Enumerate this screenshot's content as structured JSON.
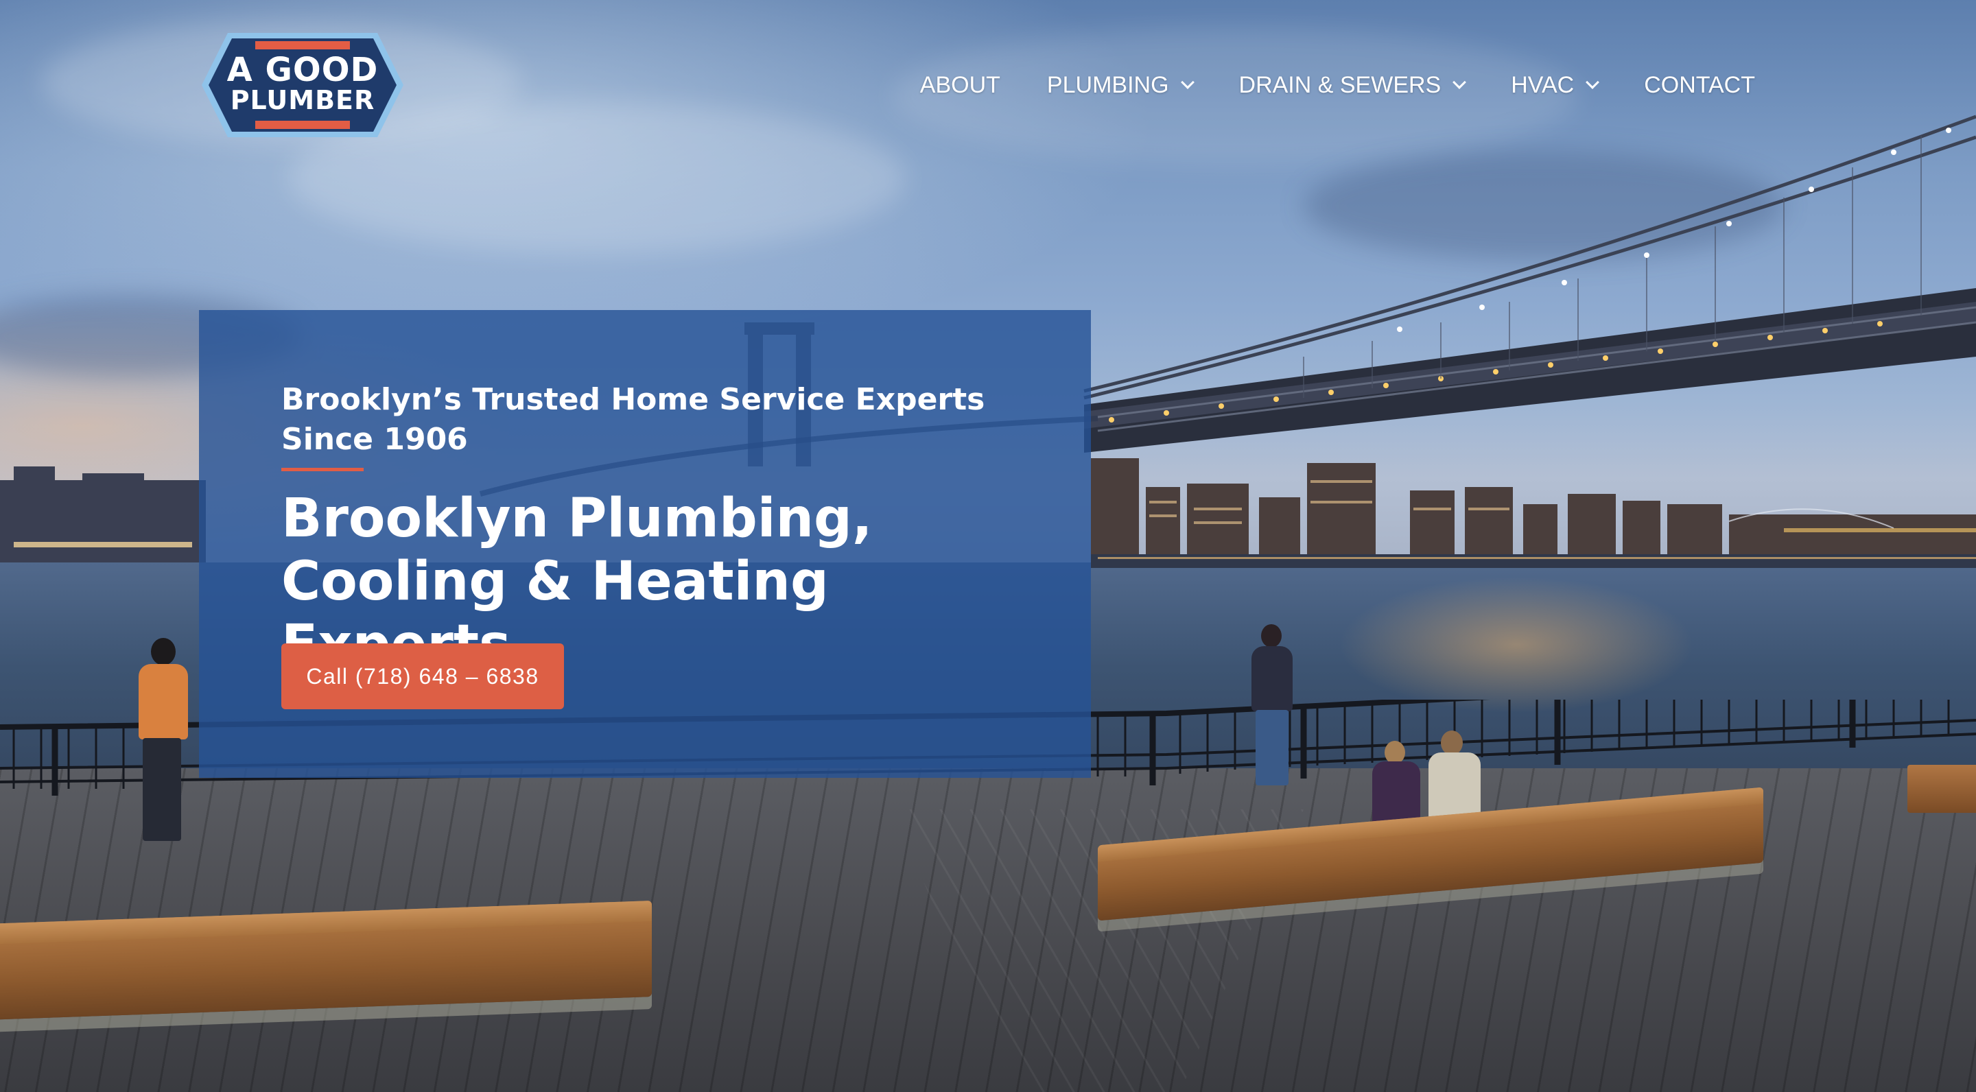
{
  "brand": {
    "logo_line1": "A GOOD",
    "logo_line2": "PLUMBER",
    "colors": {
      "navy": "#1f3b6b",
      "accent": "#e25d45",
      "light_blue": "#8fc3ea"
    }
  },
  "nav": {
    "items": [
      {
        "label": "ABOUT",
        "has_dropdown": false
      },
      {
        "label": "PLUMBING",
        "has_dropdown": true
      },
      {
        "label": "DRAIN & SEWERS",
        "has_dropdown": true
      },
      {
        "label": "HVAC",
        "has_dropdown": true
      },
      {
        "label": "CONTACT",
        "has_dropdown": false
      }
    ]
  },
  "hero": {
    "eyebrow": "Brooklyn’s Trusted Home Service Experts Since 1906",
    "headline": "Brooklyn Plumbing, Cooling & Heating Experts",
    "cta_label": "Call (718) 648 – 6838",
    "panel_color": "#255296",
    "cta_color": "#dd5f45"
  }
}
